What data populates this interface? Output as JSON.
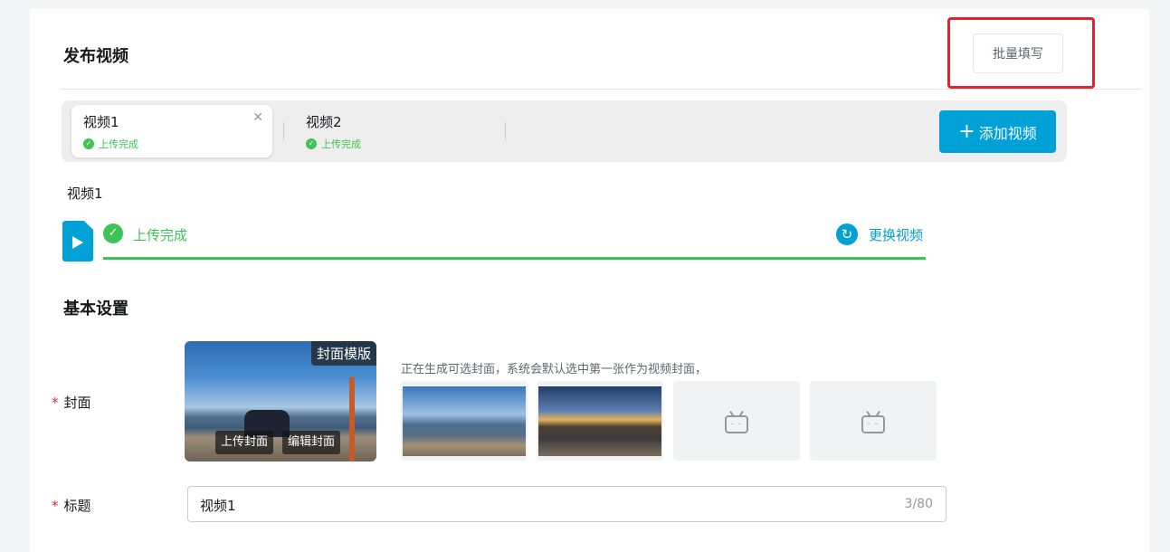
{
  "header": {
    "title": "发布视频",
    "batch_fill_label": "批量填写"
  },
  "tabs": [
    {
      "label": "视频1",
      "status": "上传完成",
      "active": true
    },
    {
      "label": "视频2",
      "status": "上传完成",
      "active": false
    }
  ],
  "add_video_label": "添加视频",
  "current_video": {
    "label": "视频1",
    "upload_status": "上传完成",
    "replace_label": "更换视频",
    "progress_percent": 100
  },
  "basic_settings": {
    "title": "基本设置",
    "cover": {
      "required_mark": "*",
      "label": "封面",
      "template_tag": "封面模版",
      "upload_label": "上传封面",
      "edit_label": "编辑封面",
      "hint": "正在生成可选封面，系统会默认选中第一张作为视频封面，"
    },
    "title_field": {
      "required_mark": "*",
      "label": "标题",
      "value": "视频1",
      "counter": "3/80"
    }
  },
  "colors": {
    "accent": "#00a1d6",
    "success": "#3ec356",
    "required": "#e8202b",
    "highlight": "#e8202b"
  },
  "icons": [
    "close-icon",
    "check-circle-icon",
    "video-file-icon",
    "refresh-icon",
    "plus-icon",
    "bilibili-tv-icon"
  ]
}
